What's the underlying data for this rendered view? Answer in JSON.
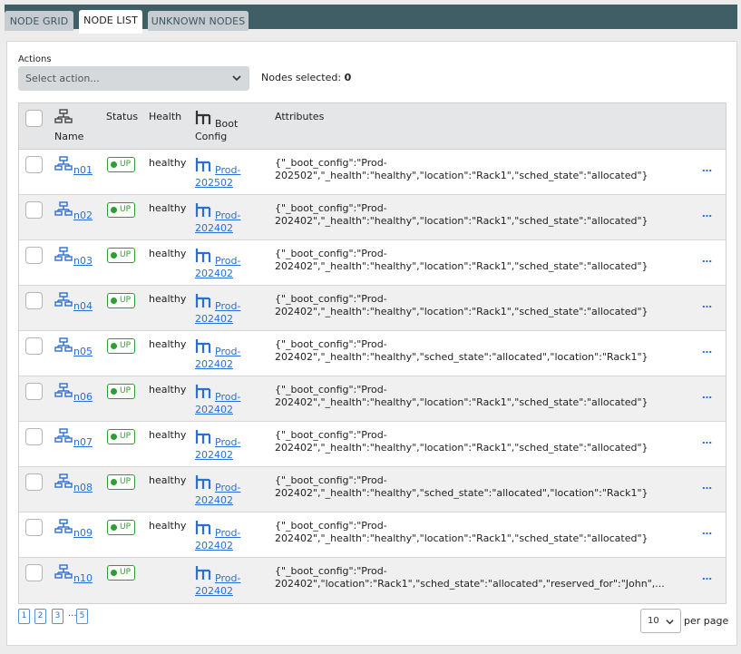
{
  "tabs": [
    {
      "label": "NODE GRID"
    },
    {
      "label": "NODE LIST"
    },
    {
      "label": "UNKNOWN NODES"
    }
  ],
  "actions": {
    "label": "Actions",
    "placeholder": "Select action...",
    "selected_label": "Nodes selected:",
    "selected_count": "0"
  },
  "table": {
    "headers": {
      "name": "Name",
      "status": "Status",
      "health": "Health",
      "boot_line1": "Boot",
      "boot_line2": "Config",
      "attributes": "Attributes"
    },
    "rows": [
      {
        "name": "n01",
        "status": "UP",
        "health": "healthy",
        "boot1": "Prod-",
        "boot2": "202502",
        "attr1": "{\"_boot_config\":\"Prod-",
        "attr2": "202502\",\"_health\":\"healthy\",\"location\":\"Rack1\",\"sched_state\":\"allocated\"}",
        "more": "…"
      },
      {
        "name": "n02",
        "status": "UP",
        "health": "healthy",
        "boot1": "Prod-",
        "boot2": "202402",
        "attr1": "{\"_boot_config\":\"Prod-",
        "attr2": "202402\",\"_health\":\"healthy\",\"location\":\"Rack1\",\"sched_state\":\"allocated\"}",
        "more": "…"
      },
      {
        "name": "n03",
        "status": "UP",
        "health": "healthy",
        "boot1": "Prod-",
        "boot2": "202402",
        "attr1": "{\"_boot_config\":\"Prod-",
        "attr2": "202402\",\"_health\":\"healthy\",\"location\":\"Rack1\",\"sched_state\":\"allocated\"}",
        "more": "…"
      },
      {
        "name": "n04",
        "status": "UP",
        "health": "healthy",
        "boot1": "Prod-",
        "boot2": "202402",
        "attr1": "{\"_boot_config\":\"Prod-",
        "attr2": "202402\",\"_health\":\"healthy\",\"location\":\"Rack1\",\"sched_state\":\"allocated\"}",
        "more": "…"
      },
      {
        "name": "n05",
        "status": "UP",
        "health": "healthy",
        "boot1": "Prod-",
        "boot2": "202402",
        "attr1": "{\"_boot_config\":\"Prod-",
        "attr2": "202402\",\"_health\":\"healthy\",\"sched_state\":\"allocated\",\"location\":\"Rack1\"}",
        "more": "…"
      },
      {
        "name": "n06",
        "status": "UP",
        "health": "healthy",
        "boot1": "Prod-",
        "boot2": "202402",
        "attr1": "{\"_boot_config\":\"Prod-",
        "attr2": "202402\",\"_health\":\"healthy\",\"location\":\"Rack1\",\"sched_state\":\"allocated\"}",
        "more": "…"
      },
      {
        "name": "n07",
        "status": "UP",
        "health": "healthy",
        "boot1": "Prod-",
        "boot2": "202402",
        "attr1": "{\"_boot_config\":\"Prod-",
        "attr2": "202402\",\"_health\":\"healthy\",\"location\":\"Rack1\",\"sched_state\":\"allocated\"}",
        "more": "…"
      },
      {
        "name": "n08",
        "status": "UP",
        "health": "healthy",
        "boot1": "Prod-",
        "boot2": "202402",
        "attr1": "{\"_boot_config\":\"Prod-",
        "attr2": "202402\",\"_health\":\"healthy\",\"sched_state\":\"allocated\",\"location\":\"Rack1\"}",
        "more": "…"
      },
      {
        "name": "n09",
        "status": "UP",
        "health": "healthy",
        "boot1": "Prod-",
        "boot2": "202402",
        "attr1": "{\"_boot_config\":\"Prod-",
        "attr2": "202402\",\"_health\":\"healthy\",\"location\":\"Rack1\",\"sched_state\":\"allocated\"}",
        "more": "…"
      },
      {
        "name": "n10",
        "status": "UP",
        "health": "",
        "boot1": "Prod-",
        "boot2": "202402",
        "attr1": "{\"_boot_config\":\"Prod-",
        "attr2": "202402\",\"location\":\"Rack1\",\"sched_state\":\"allocated\",\"reserved_for\":\"John\",...",
        "more": "…"
      }
    ]
  },
  "pagination": {
    "pages": [
      "1",
      "2",
      "3",
      "5"
    ],
    "ellipsis": "...",
    "per_page_value": "10",
    "per_page_label": "per page"
  },
  "colors": {
    "tabbar": "#3f5e66",
    "link": "#2a6fd6",
    "status_up": "#2e9d34"
  },
  "icons": {
    "name_header": "node-tree-icon",
    "boot_header": "boot-config-icon",
    "node": "node-tree-icon",
    "boot": "boot-config-icon"
  }
}
